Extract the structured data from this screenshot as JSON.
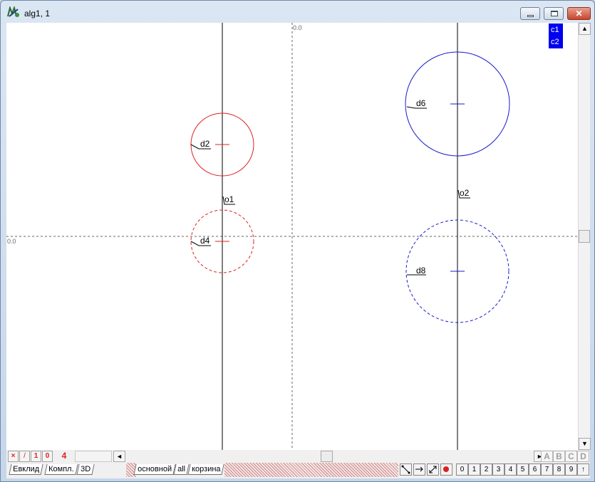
{
  "window": {
    "title": "alg1, 1"
  },
  "controls": {
    "minimize": "–",
    "maximize": "□",
    "close": "✕"
  },
  "canvas": {
    "origin_label_top": "0.0",
    "origin_label_left": "0.0",
    "legend": [
      "c1",
      "c2"
    ],
    "labels": {
      "d2": "d2",
      "d4": "d4",
      "d6": "d6",
      "d8": "d8",
      "o1": "o1",
      "o2": "o2"
    },
    "colors": {
      "red": "#e02020",
      "blue": "#1a1ad0",
      "legend_bg": "#0000f0"
    }
  },
  "toolbar_row1": {
    "cross_icon": "×",
    "slash_icon": "/",
    "one": "1",
    "zero": "0",
    "count": "4",
    "scroll_left": "◄",
    "scroll_right": "►",
    "letters": [
      "A",
      "B",
      "C",
      "D"
    ]
  },
  "tabs_left": [
    "Евклид",
    "Компл.",
    "3D"
  ],
  "tabs_layers": [
    "основной",
    "all",
    "корзина"
  ],
  "numbers": [
    "0",
    "1",
    "2",
    "3",
    "4",
    "5",
    "6",
    "7",
    "8",
    "9"
  ],
  "up_arrow": "↑",
  "scroll": {
    "up": "▲",
    "down": "▼"
  }
}
